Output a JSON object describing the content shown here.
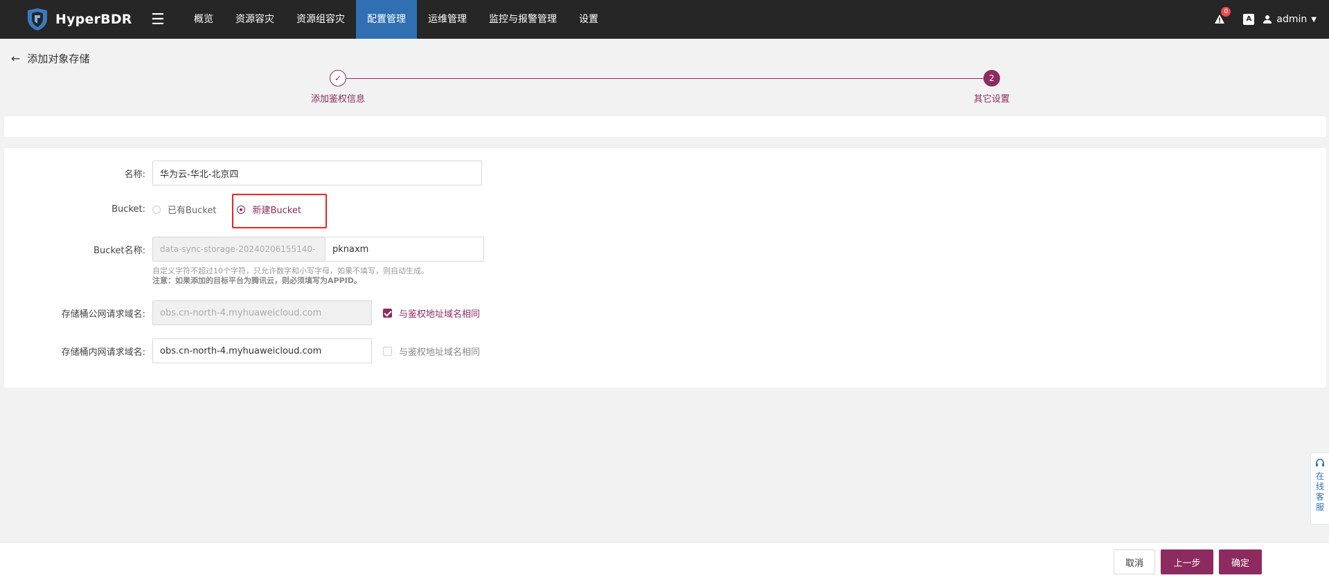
{
  "app": {
    "name": "HyperBDR",
    "nav": [
      {
        "label": "概览"
      },
      {
        "label": "资源容灾"
      },
      {
        "label": "资源组容灾"
      },
      {
        "label": "配置管理",
        "active": true
      },
      {
        "label": "运维管理"
      },
      {
        "label": "监控与报警管理"
      },
      {
        "label": "设置"
      }
    ],
    "alert_count": "0",
    "font_icon": "A",
    "user": "admin"
  },
  "page": {
    "title": "添加对象存储",
    "steps": [
      {
        "label": "添加鉴权信息",
        "status": "done"
      },
      {
        "label": "其它设置",
        "status": "current",
        "number": "2"
      }
    ]
  },
  "form": {
    "name_label": "名称:",
    "name_value": "华为云-华北-北京四",
    "bucket_label": "Bucket:",
    "bucket_options": [
      {
        "label": "已有Bucket",
        "selected": false
      },
      {
        "label": "新建Bucket",
        "selected": true
      }
    ],
    "bucket_name_label": "Bucket名称:",
    "bucket_prefix": "data-sync-storage-20240206155140-",
    "bucket_suffix": "pknaxm",
    "hint_line1": "自定义字符不超过10个字符，只允许数字和小写字母，如果不填写，则自动生成。",
    "hint_line2": "注意：如果添加的目标平台为腾讯云，则必须填写为APPID。",
    "public_endpoint_label": "存储桶公网请求域名:",
    "public_endpoint_value": "obs.cn-north-4.myhuaweicloud.com",
    "public_same_label": "与鉴权地址域名相同",
    "public_same_checked": true,
    "internal_endpoint_label": "存储桶内网请求域名:",
    "internal_endpoint_value": "obs.cn-north-4.myhuaweicloud.com",
    "internal_same_label": "与鉴权地址域名相同",
    "internal_same_checked": false
  },
  "footer": {
    "cancel": "取消",
    "prev": "上一步",
    "ok": "确定"
  },
  "service": {
    "label": "在线客服"
  },
  "colors": {
    "accent": "#8d2a5f",
    "nav_active": "#2f6fb2",
    "topbar": "#262626",
    "highlight": "#ee2222"
  }
}
